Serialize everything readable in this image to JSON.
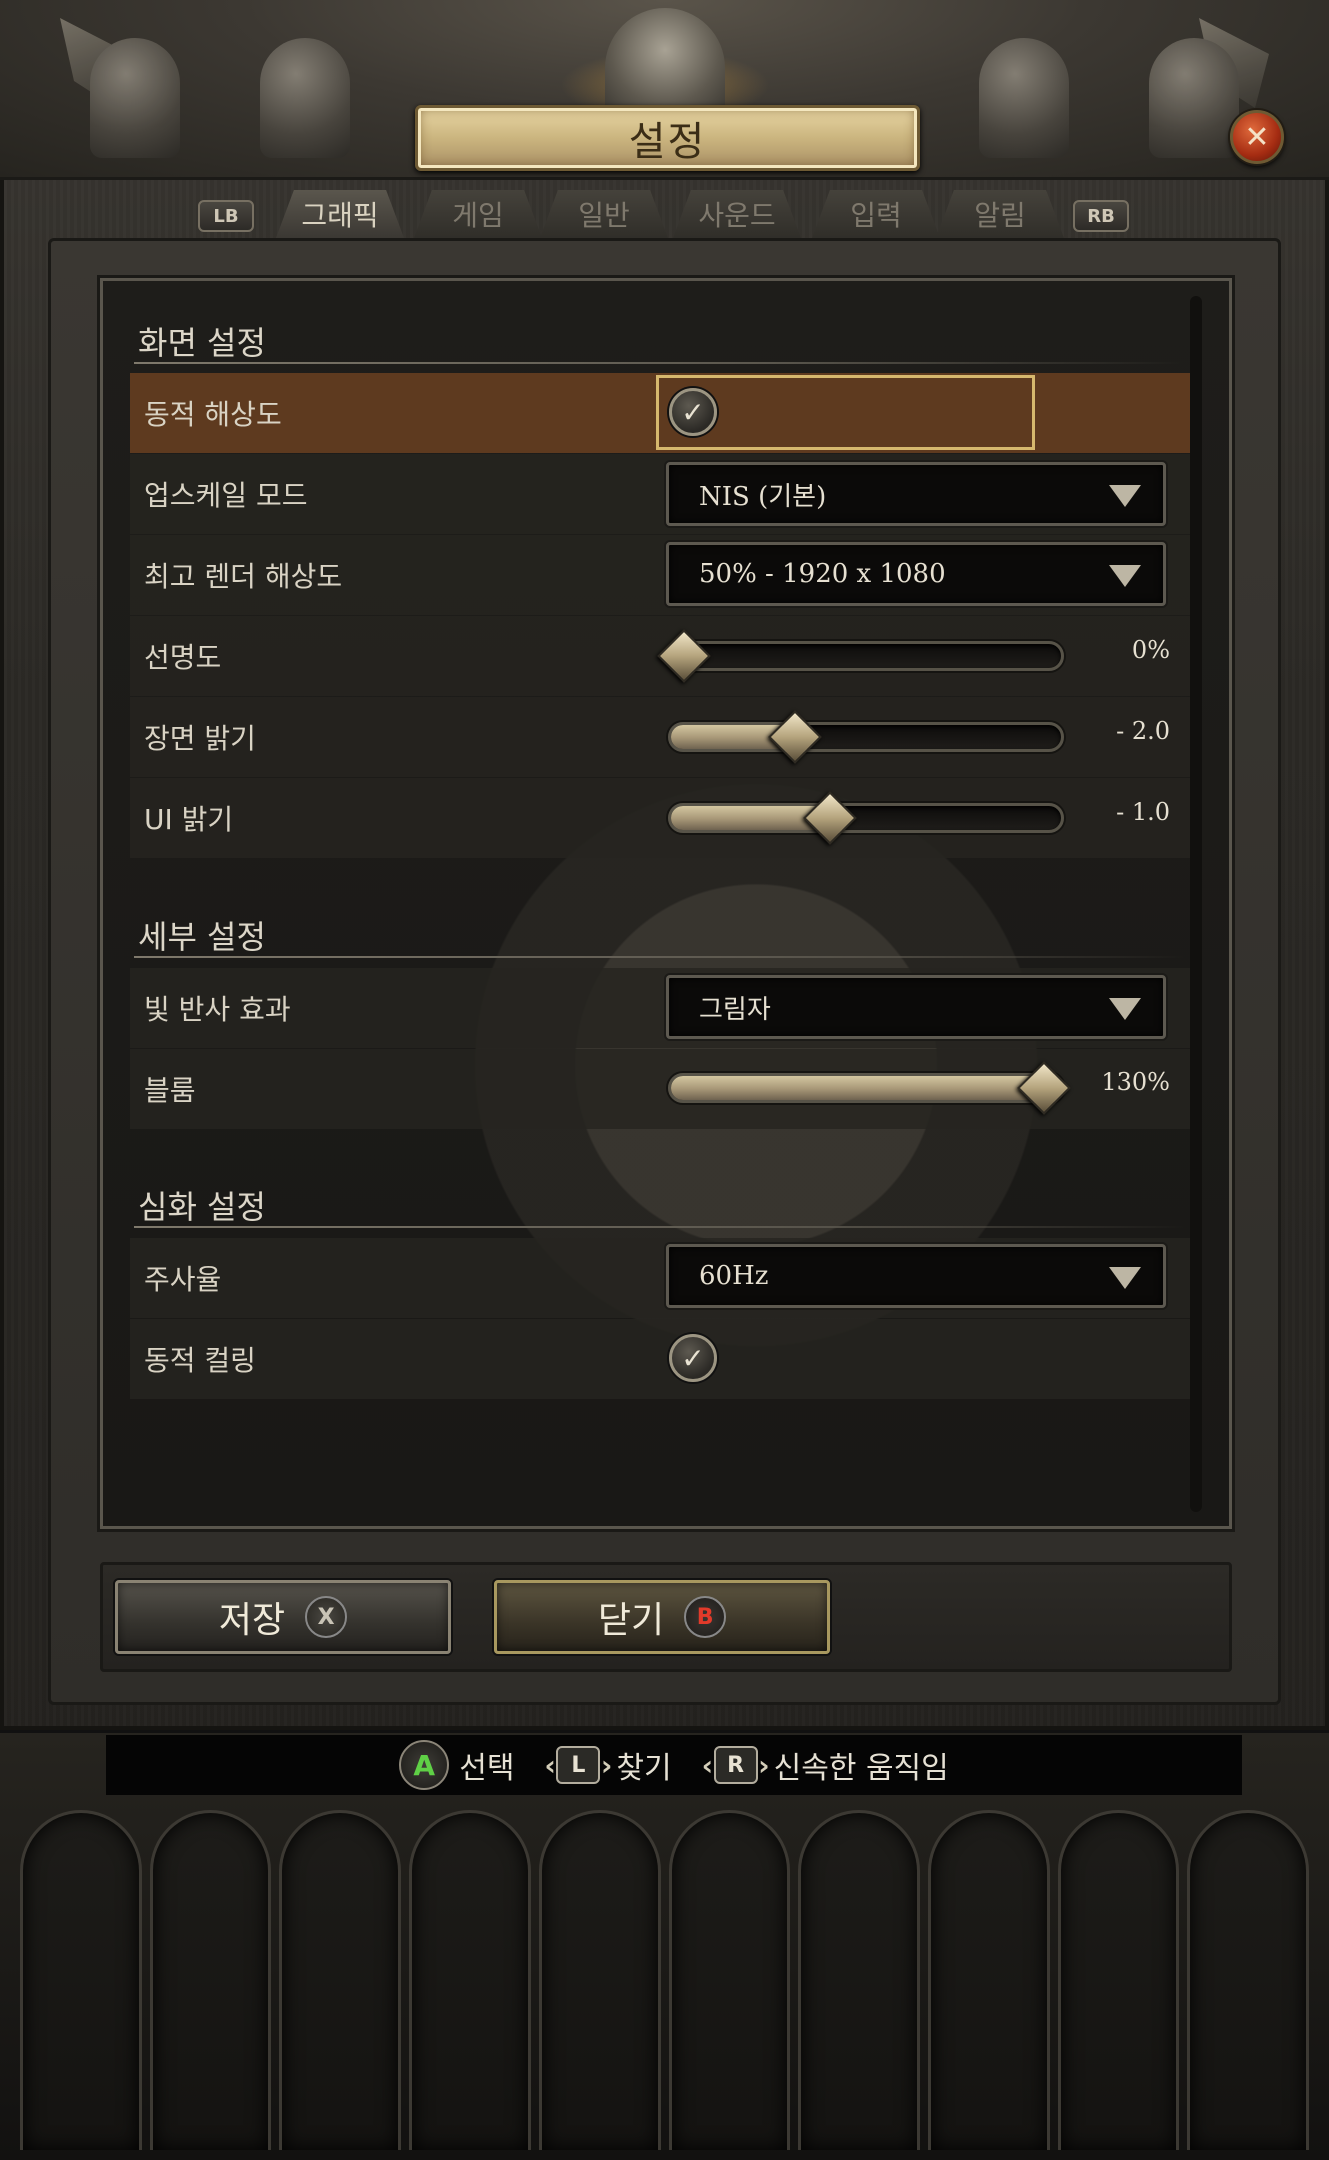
{
  "window": {
    "title": "설정",
    "close_icon": "close-icon"
  },
  "tabs": {
    "left_bumper": "LB",
    "right_bumper": "RB",
    "items": [
      {
        "label": "그래픽",
        "active": true
      },
      {
        "label": "게임",
        "active": false
      },
      {
        "label": "일반",
        "active": false
      },
      {
        "label": "사운드",
        "active": false
      },
      {
        "label": "입력",
        "active": false
      },
      {
        "label": "알림",
        "active": false
      }
    ]
  },
  "sections": {
    "display": "화면 설정",
    "detail": "세부 설정",
    "advanced": "심화 설정"
  },
  "settings": {
    "dynamic_resolution": {
      "label": "동적 해상도",
      "checked": true
    },
    "upscale_mode": {
      "label": "업스케일 모드",
      "value": "NIS (기본)"
    },
    "max_render_res": {
      "label": "최고 렌더 해상도",
      "value": "50% - 1920 x 1080"
    },
    "sharpness": {
      "label": "선명도",
      "value": "0%",
      "fill": 0.04
    },
    "scene_brightness": {
      "label": "장면 밝기",
      "value": "- 2.0",
      "fill": 0.32
    },
    "ui_brightness": {
      "label": "UI 밝기",
      "value": "- 1.0",
      "fill": 0.41
    },
    "reflections": {
      "label": "빛 반사 효과",
      "value": "그림자"
    },
    "bloom": {
      "label": "블룸",
      "value": "130%",
      "fill": 0.95
    },
    "refresh_rate": {
      "label": "주사율",
      "value": "60Hz"
    },
    "dynamic_culling": {
      "label": "동적 컬링",
      "checked": true
    }
  },
  "buttons": {
    "save": {
      "label": "저장",
      "glyph": "X"
    },
    "close": {
      "label": "닫기",
      "glyph": "B"
    }
  },
  "hints": [
    {
      "glyph": "A",
      "label": "선택"
    },
    {
      "glyph": "L",
      "label": "찾기"
    },
    {
      "glyph": "R",
      "label": "신속한 움직임"
    }
  ],
  "colors": {
    "focus_row": "#5e3a1f",
    "focus_border": "#d6b86e",
    "title_plate": "#cbb57f",
    "close_button": "#a52c12",
    "a_button": "#5fd046",
    "b_button": "#e23a2a"
  }
}
